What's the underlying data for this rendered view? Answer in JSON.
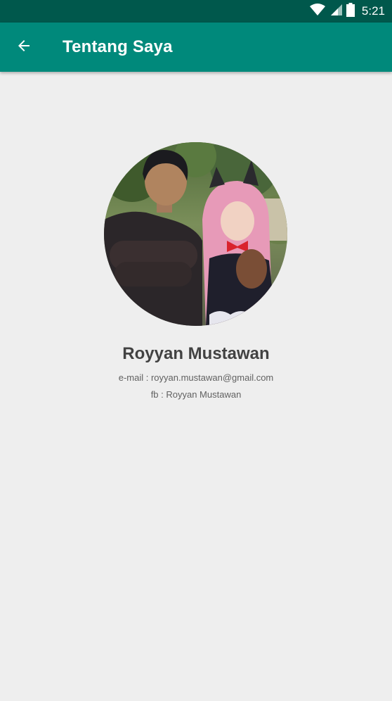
{
  "status_bar": {
    "time": "5:21",
    "background": "#00584c",
    "icons": [
      "wifi-icon",
      "cell-signal-icon",
      "battery-icon"
    ]
  },
  "app_bar": {
    "title": "Tentang Saya",
    "background": "#00897b",
    "back_icon": "arrow-left-icon"
  },
  "profile": {
    "name": "Royyan Mustawan",
    "email": "e-mail : royyan.mustawan@gmail.com",
    "fb": "fb : Royyan Mustawan"
  }
}
